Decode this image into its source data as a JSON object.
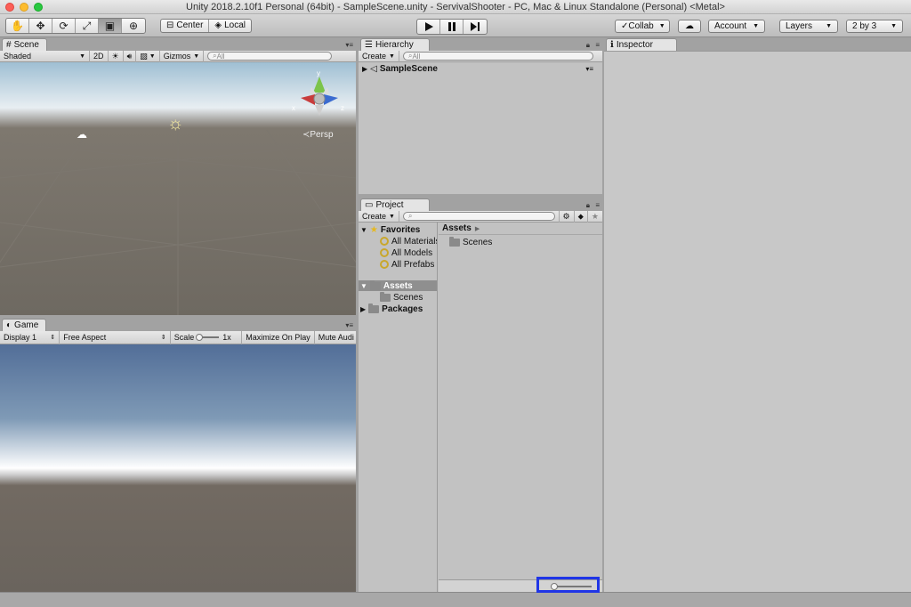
{
  "window": {
    "title": "Unity 2018.2.10f1 Personal (64bit) - SampleScene.unity - ServivalShooter - PC, Mac & Linux Standalone (Personal) <Metal>"
  },
  "toolbar": {
    "pivot": {
      "center": "Center",
      "local": "Local"
    },
    "collab": "Collab",
    "account": "Account",
    "layers": "Layers",
    "layout": "2 by 3"
  },
  "scene": {
    "tab": "Scene",
    "shading": "Shaded",
    "mode_2d": "2D",
    "gizmos": "Gizmos",
    "search_placeholder": "All",
    "persp": "Persp",
    "axis_x": "x",
    "axis_y": "y",
    "axis_z": "z"
  },
  "game": {
    "tab": "Game",
    "display": "Display 1",
    "aspect": "Free Aspect",
    "scale_label": "Scale",
    "scale_value": "1x",
    "maximize": "Maximize On Play",
    "mute": "Mute Audi"
  },
  "hierarchy": {
    "tab": "Hierarchy",
    "create": "Create",
    "search_placeholder": "All",
    "scene_name": "SampleScene"
  },
  "project": {
    "tab": "Project",
    "create": "Create",
    "favorites": "Favorites",
    "fav_items": [
      "All Materials",
      "All Models",
      "All Prefabs"
    ],
    "assets": "Assets",
    "scenes": "Scenes",
    "packages": "Packages",
    "breadcrumb": "Assets",
    "content_items": [
      "Scenes"
    ]
  },
  "inspector": {
    "tab": "Inspector"
  }
}
